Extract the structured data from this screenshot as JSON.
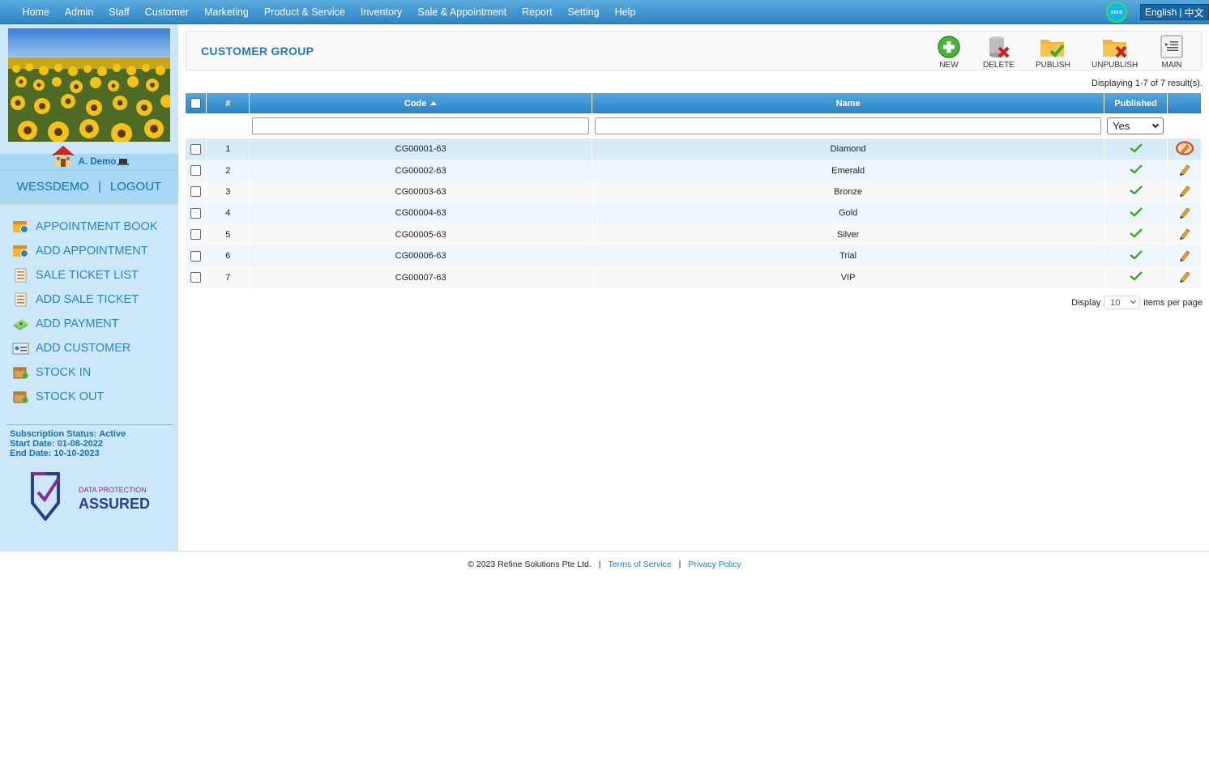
{
  "topmenu": {
    "items": [
      "Home",
      "Admin",
      "Staff",
      "Customer",
      "Marketing",
      "Product & Service",
      "Inventory",
      "Sale & Appointment",
      "Report",
      "Setting",
      "Help"
    ],
    "xero_label": "xero",
    "lang_en": "English",
    "lang_sep": "|",
    "lang_cn": "中文"
  },
  "sidebar": {
    "user_name": "A. Demo",
    "account": "WESSDEMO",
    "separator": "|",
    "logout": "LOGOUT",
    "quicklinks": [
      {
        "label": "APPOINTMENT BOOK",
        "icon": "calendar-icon"
      },
      {
        "label": "ADD APPOINTMENT",
        "icon": "calendar-add-icon"
      },
      {
        "label": "SALE TICKET LIST",
        "icon": "ticket-list-icon"
      },
      {
        "label": "ADD SALE TICKET",
        "icon": "ticket-add-icon"
      },
      {
        "label": "ADD PAYMENT",
        "icon": "money-icon"
      },
      {
        "label": "ADD CUSTOMER",
        "icon": "customer-card-icon"
      },
      {
        "label": "STOCK IN",
        "icon": "box-in-icon"
      },
      {
        "label": "STOCK OUT",
        "icon": "box-out-icon"
      }
    ],
    "subscription_status": "Subscription Status: Active",
    "start_date": "Start Date: 01-08-2022",
    "end_date": "End Date: 10-10-2023",
    "badge_top": "DATA PROTECTION",
    "badge_bottom": "ASSURED"
  },
  "header": {
    "title": "CUSTOMER GROUP",
    "toolbar": {
      "new": "NEW",
      "delete": "DELETE",
      "publish": "PUBLISH",
      "unpublish": "UNPUBLISH",
      "main": "MAIN"
    }
  },
  "result_info": "Displaying 1-7 of 7 result(s).",
  "table": {
    "columns": {
      "num": "#",
      "code": "Code",
      "name": "Name",
      "published": "Published"
    },
    "filter_published": "Yes",
    "rows": [
      {
        "num": "1",
        "code": "CG00001-63",
        "name": "Diamond"
      },
      {
        "num": "2",
        "code": "CG00002-63",
        "name": "Emerald"
      },
      {
        "num": "3",
        "code": "CG00003-63",
        "name": "Bronze"
      },
      {
        "num": "4",
        "code": "CG00004-63",
        "name": "Gold"
      },
      {
        "num": "5",
        "code": "CG00005-63",
        "name": "Silver"
      },
      {
        "num": "6",
        "code": "CG00006-63",
        "name": "Trial"
      },
      {
        "num": "7",
        "code": "CG00007-63",
        "name": "VIP"
      }
    ]
  },
  "pagination": {
    "display_label": "Display",
    "per_page_value": "10",
    "items_label": "items per page"
  },
  "footer": {
    "copyright": "© 2023 Refine Solutions Pte Ltd.",
    "sep": "|",
    "terms": "Terms of Service",
    "privacy": "Privacy Policy"
  },
  "colors": {
    "accent": "#1f7cc0",
    "sidebar_bg": "#cbe7f8",
    "header_blue": "#2c83c4"
  }
}
